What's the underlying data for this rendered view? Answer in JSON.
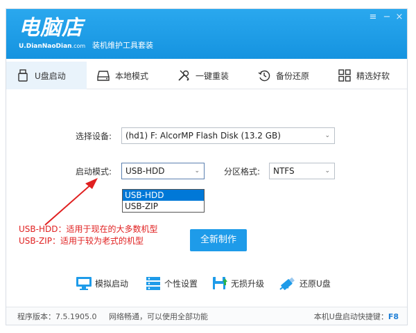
{
  "header": {
    "logo": "电脑店",
    "logo_url_bold": "U.DianNaoDian",
    "logo_url_suffix": ".com",
    "tagline": "装机维护工具套装",
    "controls": [
      "≡",
      "−",
      "×"
    ]
  },
  "nav": [
    {
      "label": "U盘启动",
      "icon": "usb-drive-icon",
      "active": true
    },
    {
      "label": "本地模式",
      "icon": "hard-disk-icon",
      "active": false
    },
    {
      "label": "一键重装",
      "icon": "tools-icon",
      "active": false
    },
    {
      "label": "备份还原",
      "icon": "restore-icon",
      "active": false
    },
    {
      "label": "精选好软",
      "icon": "grid-apps-icon",
      "active": false
    }
  ],
  "form": {
    "device_label": "选择设备:",
    "device_value": "(hd1) F: AlcorMP Flash Disk (13.2 GB)",
    "boot_mode_label": "启动模式:",
    "boot_mode_value": "USB-HDD",
    "boot_mode_options": [
      "USB-HDD",
      "USB-ZIP"
    ],
    "partition_label": "分区格式:",
    "partition_value": "NTFS"
  },
  "annotation": {
    "line1": "USB-HDD：适用于现在的大多数机型",
    "line2": "USB-ZIP：适用于较为老式的机型",
    "color": "#e02020"
  },
  "primary_button": "全新制作",
  "tools": [
    {
      "label": "模拟启动",
      "icon": "monitor-icon"
    },
    {
      "label": "个性设置",
      "icon": "settings-list-icon"
    },
    {
      "label": "无损升级",
      "icon": "upgrade-icon"
    },
    {
      "label": "还原U盘",
      "icon": "usb-restore-icon"
    }
  ],
  "footer": {
    "version": "程序版本：7.5.1905.0",
    "network": "网络畅通，可以使用全部功能",
    "shortcut_label": "本机U盘启动快捷键：",
    "shortcut_key": "F8"
  },
  "colors": {
    "header": "#1e9be9",
    "accent": "#1e9be9",
    "selected": "#0078d7"
  }
}
